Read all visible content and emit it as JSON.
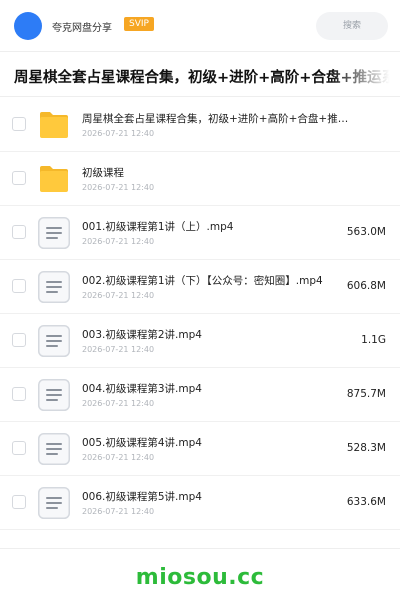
{
  "header": {
    "app_name": "夸克网盘分享",
    "badge": "SVIP",
    "search_placeholder": "搜索"
  },
  "folder_title": "周星棋全套占星课程合集，初级+进阶+高阶+合盘+推运系列",
  "files": [
    {
      "type": "folder",
      "name": "周星棋全套占星课程合集，初级+进阶+高阶+合盘+推运系列",
      "date": "2026-07-21 12:40",
      "size": ""
    },
    {
      "type": "folder",
      "name": "初级课程",
      "date": "2026-07-21 12:40",
      "size": ""
    },
    {
      "type": "file",
      "name": "001.初级课程第1讲（上）.mp4",
      "date": "2026-07-21 12:40",
      "size": "563.0M"
    },
    {
      "type": "file",
      "name": "002.初级课程第1讲（下）【公众号：密知圈】.mp4",
      "date": "2026-07-21 12:40",
      "size": "606.8M"
    },
    {
      "type": "file",
      "name": "003.初级课程第2讲.mp4",
      "date": "2026-07-21 12:40",
      "size": "1.1G"
    },
    {
      "type": "file",
      "name": "004.初级课程第3讲.mp4",
      "date": "2026-07-21 12:40",
      "size": "875.7M"
    },
    {
      "type": "file",
      "name": "005.初级课程第4讲.mp4",
      "date": "2026-07-21 12:40",
      "size": "528.3M"
    },
    {
      "type": "file",
      "name": "006.初级课程第5讲.mp4",
      "date": "2026-07-21 12:40",
      "size": "633.6M"
    }
  ],
  "watermark": "miosou.cc",
  "colors": {
    "avatar": "#2d7cf6",
    "badge": "#f6a623",
    "folder": "#ffc93c",
    "watermark": "#2dbb3a"
  }
}
